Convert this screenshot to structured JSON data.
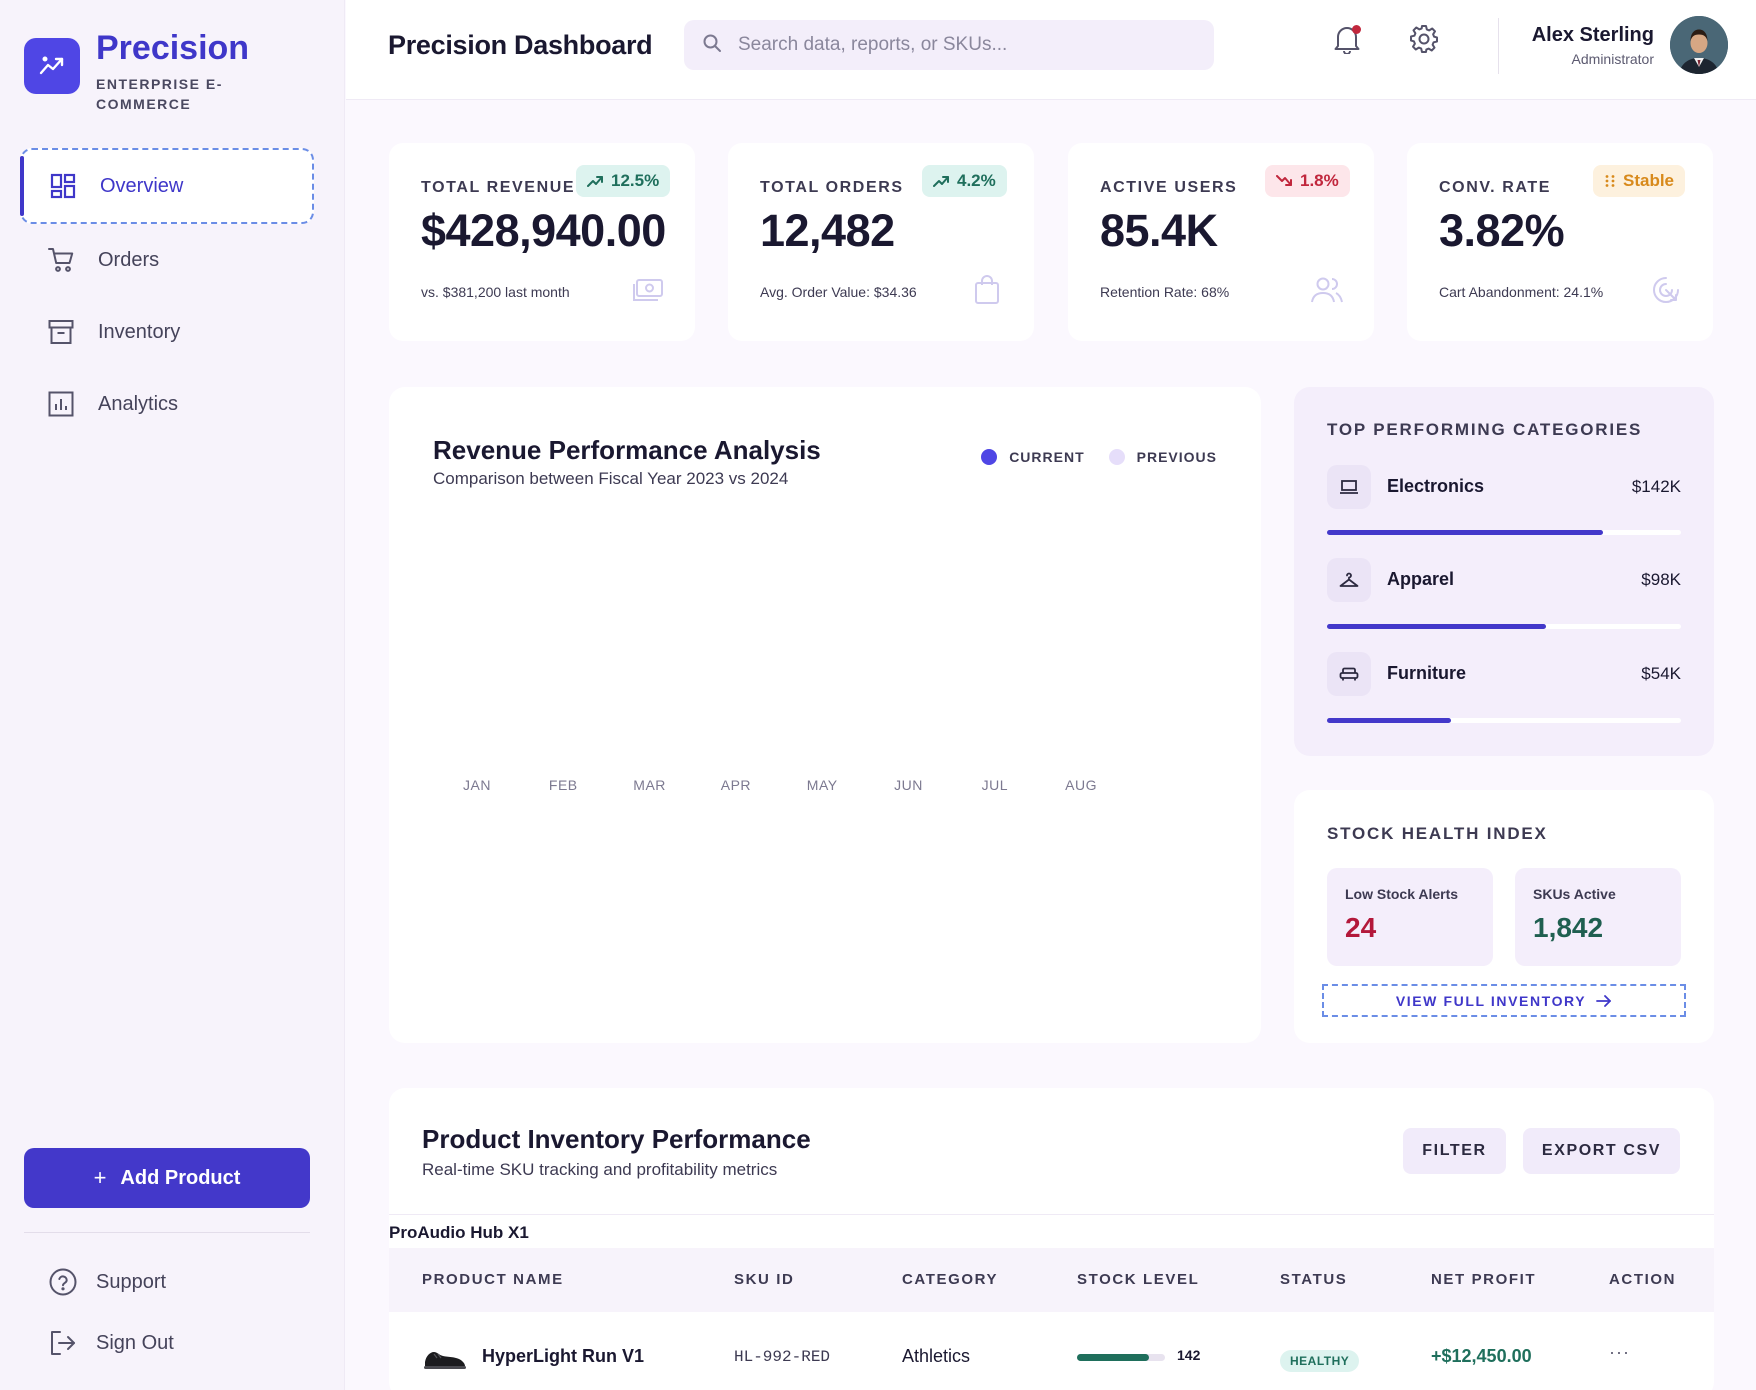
{
  "brand": {
    "title": "Precision",
    "subtitle": "ENTERPRISE E-COMMERCE"
  },
  "nav": [
    {
      "label": "Overview",
      "icon": "dashboard-icon",
      "active": true
    },
    {
      "label": "Orders",
      "icon": "cart-icon"
    },
    {
      "label": "Inventory",
      "icon": "archive-icon"
    },
    {
      "label": "Analytics",
      "icon": "analytics-icon"
    }
  ],
  "sidebar_footer": {
    "add_label": "Add Product",
    "support_label": "Support",
    "signout_label": "Sign Out"
  },
  "header": {
    "title": "Precision Dashboard",
    "search_placeholder": "Search data, reports, or SKUs...",
    "user_name": "Alex Sterling",
    "user_role": "Administrator"
  },
  "kpis": [
    {
      "label": "TOTAL REVENUE",
      "badge": "12.5%",
      "trend": "up",
      "value": "$428,940.00",
      "foot": "vs. $381,200 last month",
      "icon": "money-icon"
    },
    {
      "label": "TOTAL ORDERS",
      "badge": "4.2%",
      "trend": "up",
      "value": "12,482",
      "foot": "Avg. Order Value: $34.36",
      "icon": "bag-icon"
    },
    {
      "label": "ACTIVE USERS",
      "badge": "1.8%",
      "trend": "down",
      "value": "85.4K",
      "foot": "Retention Rate: 68%",
      "icon": "users-icon"
    },
    {
      "label": "CONV. RATE",
      "badge": "Stable",
      "trend": "flat",
      "value": "3.82%",
      "foot": "Cart Abandonment: 24.1%",
      "icon": "target-icon"
    }
  ],
  "revenue": {
    "title": "Revenue Performance Analysis",
    "subtitle": "Comparison between Fiscal Year 2023 vs 2024",
    "legend_current": "CURRENT",
    "legend_previous": "PREVIOUS",
    "colors": {
      "current": "#4f46e5",
      "previous": "#e6defa"
    }
  },
  "chart_data": {
    "type": "bar",
    "categories": [
      "JAN",
      "FEB",
      "MAR",
      "APR",
      "MAY",
      "JUN",
      "JUL",
      "AUG"
    ],
    "series": [
      {
        "name": "CURRENT",
        "values": []
      },
      {
        "name": "PREVIOUS",
        "values": []
      }
    ],
    "grid": false,
    "legend": "top-right"
  },
  "categories_panel": {
    "title": "TOP PERFORMING CATEGORIES",
    "items": [
      {
        "name": "Electronics",
        "value": "$142K",
        "share": 0.78,
        "icon": "laptop-icon"
      },
      {
        "name": "Apparel",
        "value": "$98K",
        "share": 0.62,
        "icon": "hanger-icon"
      },
      {
        "name": "Furniture",
        "value": "$54K",
        "share": 0.35,
        "icon": "sofa-icon"
      }
    ]
  },
  "stock": {
    "title": "STOCK HEALTH INDEX",
    "low_label": "Low Stock Alerts",
    "low_value": "24",
    "active_label": "SKUs Active",
    "active_value": "1,842",
    "view_label": "VIEW FULL INVENTORY",
    "colors": {
      "low": "#b3183a",
      "active": "#1f5f50"
    }
  },
  "inventory": {
    "title": "Product Inventory Performance",
    "subtitle": "Real-time SKU tracking and profitability metrics",
    "filter_label": "FILTER",
    "export_label": "EXPORT CSV",
    "stray_label": "ProAudio Hub X1",
    "columns": [
      "PRODUCT NAME",
      "SKU ID",
      "CATEGORY",
      "STOCK LEVEL",
      "STATUS",
      "NET PROFIT",
      "ACTION"
    ],
    "rows": [
      {
        "product": "HyperLight Run V1",
        "sku": "HL-992-RED",
        "category": "Athletics",
        "stock": "142",
        "stock_fill": 0.82,
        "status": "HEALTHY",
        "profit": "+$12,450.00",
        "action": "···"
      }
    ]
  }
}
